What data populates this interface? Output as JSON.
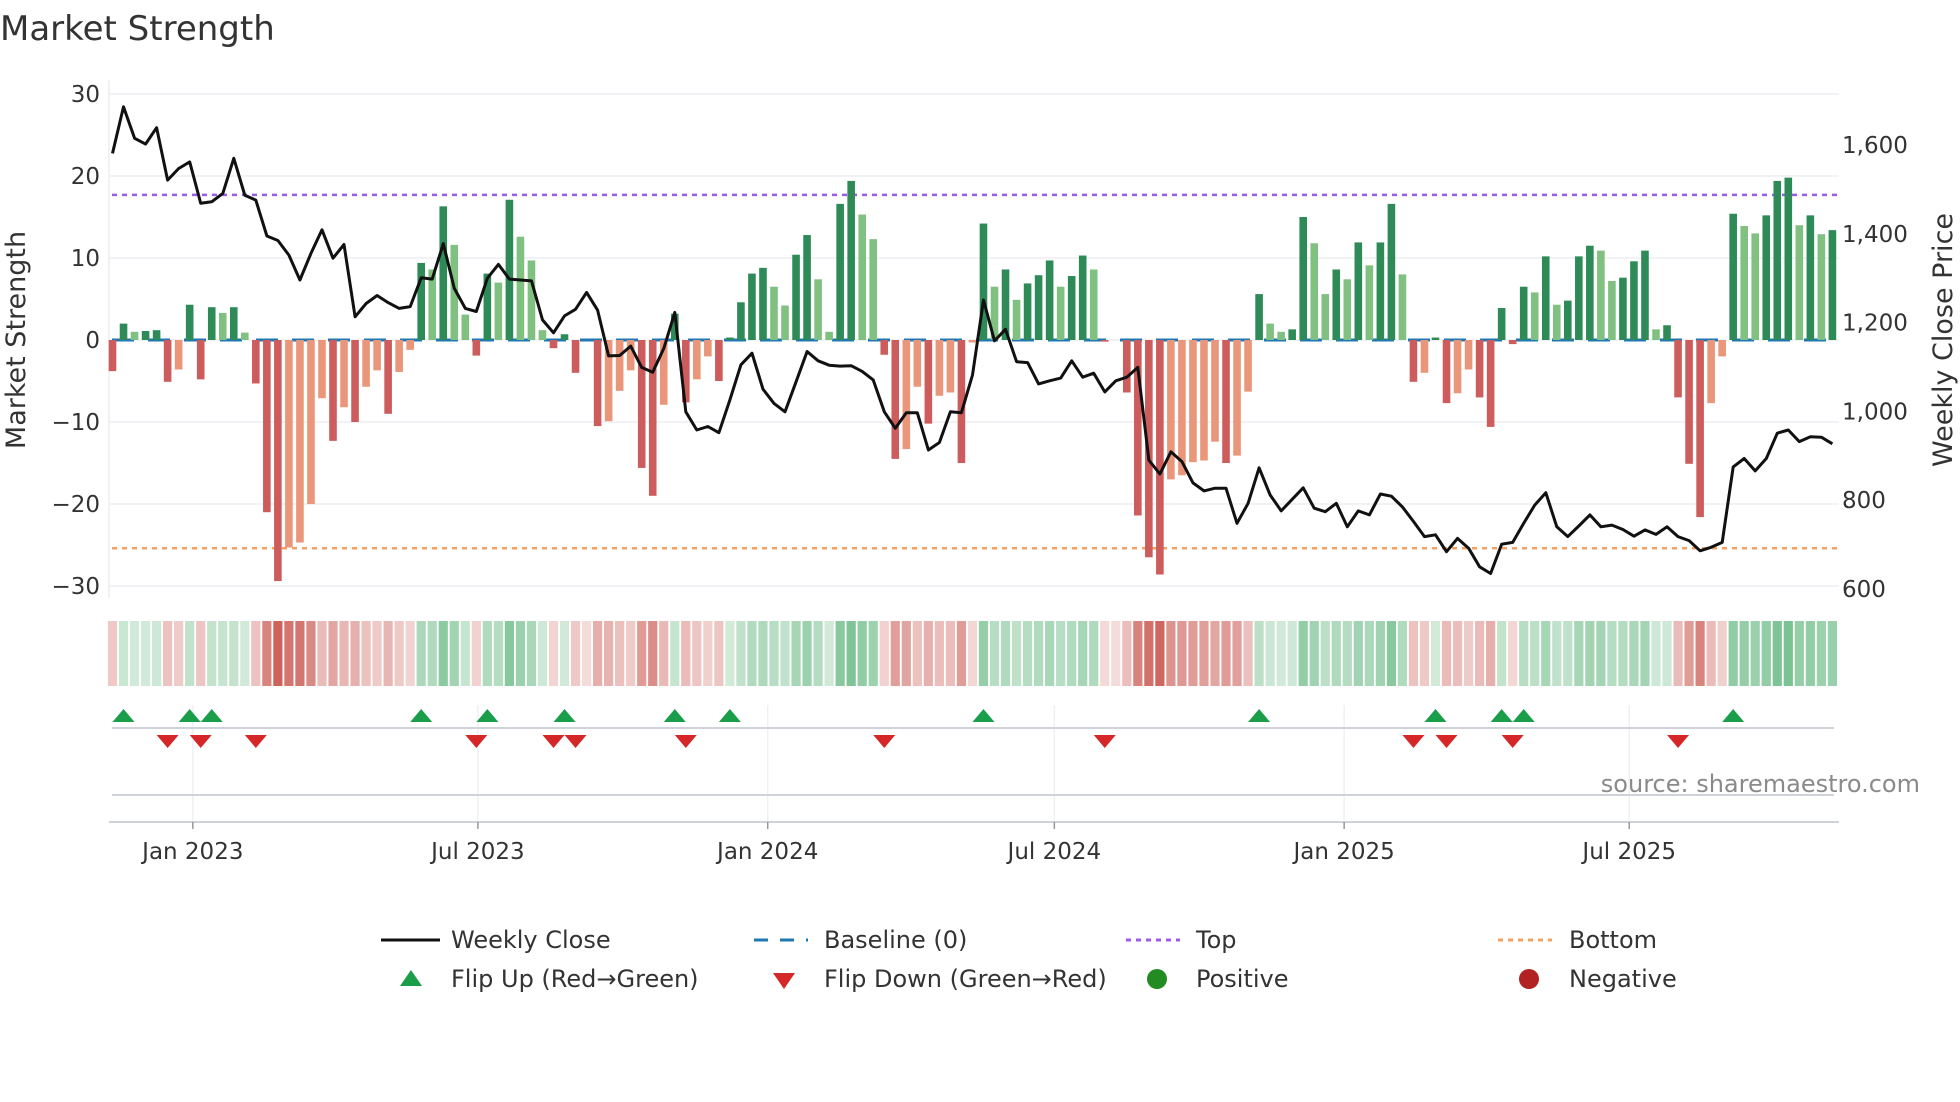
{
  "title": "Market Strength",
  "source": "source: sharemaestro.com",
  "colors": {
    "pos_strong": "#2e8b57",
    "pos_weak": "#80c080",
    "neg_strong": "#cd5c5c",
    "neg_weak": "#e9967a",
    "close": "#111111",
    "baseline": "#1f77b4",
    "top": "#9b5de5",
    "bottom": "#f4a261",
    "flip_up": "#1a9e4a",
    "flip_down": "#d62728",
    "positive": "#228b22",
    "negative": "#b22222"
  },
  "legend": {
    "close": "Weekly Close",
    "baseline": "Baseline (0)",
    "top": "Top",
    "bottom": "Bottom",
    "flip_up": "Flip Up (Red→Green)",
    "flip_down": "Flip Down (Green→Red)",
    "positive": "Positive",
    "negative": "Negative"
  },
  "chart_data": {
    "type": "bar+line",
    "title": "Market Strength",
    "ylabel": "Market Strength",
    "y2label": "Weekly Close Price",
    "ylim": [
      -31.5,
      31
    ],
    "y2lim": [
      570,
      1750
    ],
    "yticks": [
      "30",
      "20",
      "10",
      "0",
      "−10",
      "−20",
      "−30"
    ],
    "ytick_values": [
      30,
      20,
      10,
      0,
      -10,
      -20,
      -30
    ],
    "y2ticks": [
      "1,600",
      "1,400",
      "1,200",
      "1,000",
      "800",
      "600"
    ],
    "y2tick_values": [
      1600,
      1400,
      1200,
      1000,
      800,
      600
    ],
    "xticks": [
      {
        "label": "Jan 2023",
        "date": "2023-01-01"
      },
      {
        "label": "Jul 2023",
        "date": "2023-07-01"
      },
      {
        "label": "Jan 2024",
        "date": "2024-01-01"
      },
      {
        "label": "Jul 2024",
        "date": "2024-07-01"
      },
      {
        "label": "Jan 2025",
        "date": "2025-01-01"
      },
      {
        "label": "Jul 2025",
        "date": "2025-07-01"
      }
    ],
    "start_date": "2022-11-11",
    "frequency": "weekly",
    "top": 17.7,
    "bottom": -25.4,
    "baseline": 0,
    "strength": [
      -3.8,
      2,
      1,
      1.1,
      1.2,
      -5.1,
      -3.6,
      4.3,
      -4.8,
      4,
      3.3,
      4,
      0.9,
      -5.3,
      -21,
      -29.4,
      -25.3,
      -24.7,
      -20,
      -7.1,
      -12.3,
      -8.2,
      -10,
      -5.7,
      -3.7,
      -9,
      -3.9,
      -1.2,
      9.4,
      8.6,
      16.3,
      11.6,
      3.1,
      -1.9,
      8.1,
      7.0,
      17.1,
      12.6,
      9.7,
      1.2,
      -1,
      0.7,
      -4,
      0,
      -10.5,
      -9.9,
      -6.2,
      -3.7,
      -15.6,
      -19,
      -7.9,
      3.2,
      -7.6,
      -4.8,
      -2,
      -5,
      0.3,
      4.6,
      8.1,
      8.8,
      6.5,
      4.2,
      10.4,
      12.8,
      7.4,
      1,
      16.6,
      19.4,
      15.3,
      12.3,
      -1.8,
      -14.5,
      -13.3,
      -5.7,
      -10.2,
      -6.8,
      -6.4,
      -15,
      -0.3,
      14.2,
      6.5,
      8.6,
      4.9,
      6.9,
      7.9,
      9.7,
      6.5,
      7.8,
      10.3,
      8.6,
      -0.2,
      0,
      -6.4,
      -21.4,
      -26.5,
      -28.6,
      -17,
      -16.5,
      -14.9,
      -14.7,
      -12.4,
      -15,
      -14.1,
      -6.3,
      5.6,
      2,
      1,
      1.3,
      15,
      11.8,
      5.6,
      8.6,
      7.4,
      11.9,
      9.1,
      11.9,
      16.6,
      8,
      -5.1,
      -4,
      0.3,
      -7.7,
      -6.5,
      -3.6,
      -7,
      -10.6,
      3.9,
      -0.5,
      6.5,
      5.8,
      10.2,
      4.3,
      4.8,
      10.2,
      11.5,
      10.9,
      7.2,
      7.6,
      9.6,
      10.9,
      1.3,
      1.8,
      -7,
      -15.1,
      -21.6,
      -7.7,
      -2,
      15.4,
      13.9,
      13,
      15.2,
      19.4,
      19.8,
      14,
      15.2,
      12.9,
      13.4
    ],
    "close": [
      1581,
      1686,
      1615,
      1602,
      1639,
      1521,
      1547,
      1562,
      1469,
      1472,
      1491,
      1570,
      1487,
      1476,
      1395,
      1385,
      1352,
      1296,
      1356,
      1409,
      1345,
      1376,
      1213,
      1243,
      1261,
      1245,
      1232,
      1236,
      1301,
      1298,
      1378,
      1277,
      1232,
      1225,
      1300,
      1331,
      1298,
      1296,
      1294,
      1206,
      1177,
      1215,
      1230,
      1268,
      1228,
      1125,
      1126,
      1147,
      1099,
      1088,
      1142,
      1223,
      999,
      958,
      966,
      952,
      1026,
      1105,
      1131,
      1050,
      1018,
      999,
      1067,
      1135,
      1114,
      1104,
      1102,
      1103,
      1090,
      1071,
      999,
      962,
      997,
      997,
      913,
      930,
      999,
      997,
      1082,
      1251,
      1159,
      1185,
      1112,
      1110,
      1062,
      1069,
      1075,
      1114,
      1077,
      1086,
      1044,
      1069,
      1077,
      1099,
      890,
      859,
      909,
      887,
      839,
      821,
      827,
      827,
      748,
      793,
      873,
      812,
      776,
      802,
      828,
      782,
      774,
      793,
      740,
      776,
      767,
      814,
      809,
      785,
      752,
      718,
      722,
      684,
      714,
      692,
      650,
      635,
      701,
      705,
      748,
      789,
      817,
      740,
      718,
      742,
      767,
      740,
      744,
      734,
      719,
      733,
      723,
      740,
      718,
      709,
      686,
      694,
      705,
      875,
      894,
      866,
      894,
      951,
      958,
      932,
      943,
      942,
      927
    ],
    "flip_up": [
      1,
      7,
      9,
      28,
      34,
      41,
      51,
      56,
      79,
      104,
      120,
      126,
      128,
      147
    ],
    "flip_down": [
      5,
      8,
      13,
      33,
      40,
      42,
      52,
      70,
      90,
      118,
      121,
      127,
      142
    ],
    "legend_position": "bottom"
  }
}
